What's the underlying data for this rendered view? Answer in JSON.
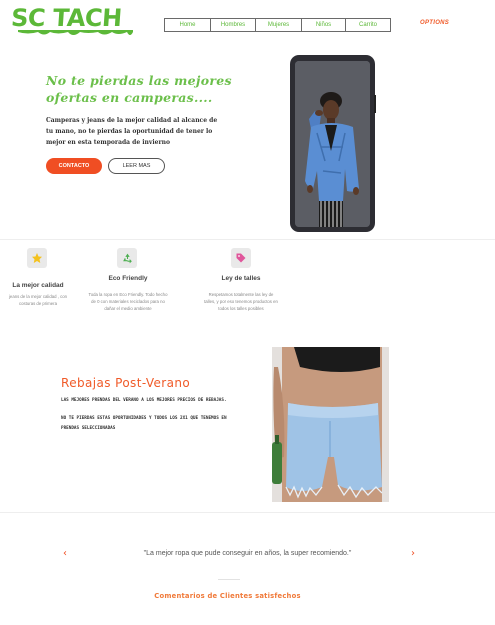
{
  "brand": {
    "logo_text": "SC TACH",
    "primary_color": "#5cb838",
    "accent_color": "#f04e23"
  },
  "nav": {
    "items": [
      {
        "label": "Home"
      },
      {
        "label": "Hombres"
      },
      {
        "label": "Mujeres"
      },
      {
        "label": "Niños"
      },
      {
        "label": "Carrito"
      }
    ],
    "options_label": "OPTIONS"
  },
  "hero": {
    "title_line1": "No te pierdas las mejores",
    "title_line2": "ofertas en camperas....",
    "text": "Camperas y jeans de la mejor calidad al alcance de tu mano, no te pierdas la oportunidad de tener lo mejor en esta temporada de invierno",
    "contact_button": "CONTACTO",
    "more_button": "LEER MAS"
  },
  "features": [
    {
      "icon": "star-icon",
      "title": "La mejor calidad",
      "text": "jeans de la mejor calidad , con costuras de primera"
    },
    {
      "icon": "recycle-icon",
      "title": "Eco Friendly",
      "text": "Toda la ropa en Eco Friendly. Todo hecho de 0 con materiales reciclados para no dañar el medio ambiente"
    },
    {
      "icon": "tag-icon",
      "title": "Ley de talles",
      "text": "Respetamos totalmente las ley de talles, y por eso tenemos productos en todos los talles posibles"
    }
  ],
  "promo": {
    "title": "Rebajas Post-Verano",
    "line1": "LAS MEJORES PRENDAS DEL VERANO A LOS MEJORES PRECIOS DE REBAJAS.",
    "line2": "NO TE PIERDAS ESTAS OPORTUNIDADES Y TODOS LOS 2X1 QUE TENEMOS EN PRENDAS SELECCIONADAS"
  },
  "testimonial": {
    "quote": "\"La mejor ropa que pude conseguir en años, la super recomiendo.\"",
    "prev": "‹",
    "next": "›",
    "section_title": "Comentarios de Clientes satisfechos"
  }
}
